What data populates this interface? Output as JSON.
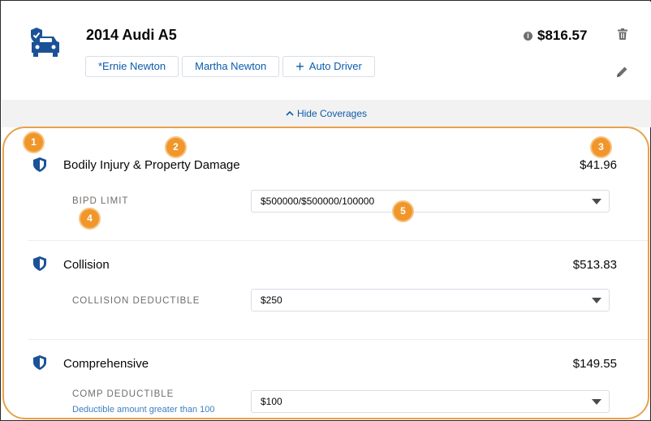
{
  "vehicle": {
    "title": "2014 Audi A5",
    "total_price": "$816.57",
    "drivers": [
      "*Ernie Newton",
      "Martha Newton"
    ],
    "add_driver_label": "Auto Driver"
  },
  "icons": {
    "vehicle": "car-shield-icon",
    "info": "info-icon",
    "delete": "trash-icon",
    "edit": "pencil-icon",
    "toggle": "chevron-up-icon",
    "coverage": "shield-icon",
    "add": "plus-icon",
    "select": "caret-down-icon"
  },
  "toggle_label": "Hide Coverages",
  "coverages": [
    {
      "name": "Bodily Injury & Property Damage",
      "price": "$41.96",
      "field_label": "BIPD LIMIT",
      "value": "$500000/$500000/100000",
      "help": ""
    },
    {
      "name": "Collision",
      "price": "$513.83",
      "field_label": "COLLISION DEDUCTIBLE",
      "value": "$250",
      "help": ""
    },
    {
      "name": "Comprehensive",
      "price": "$149.55",
      "field_label": "COMP DEDUCTIBLE",
      "value": "$100",
      "help": "Deductible amount greater than 100"
    }
  ],
  "callouts": [
    "1",
    "2",
    "3",
    "4",
    "5"
  ],
  "colors": {
    "brand_blue": "#0b5cab",
    "icon_blue": "#1b5297",
    "callout_orange": "#f0962a",
    "outline_orange": "#e8a24a"
  }
}
